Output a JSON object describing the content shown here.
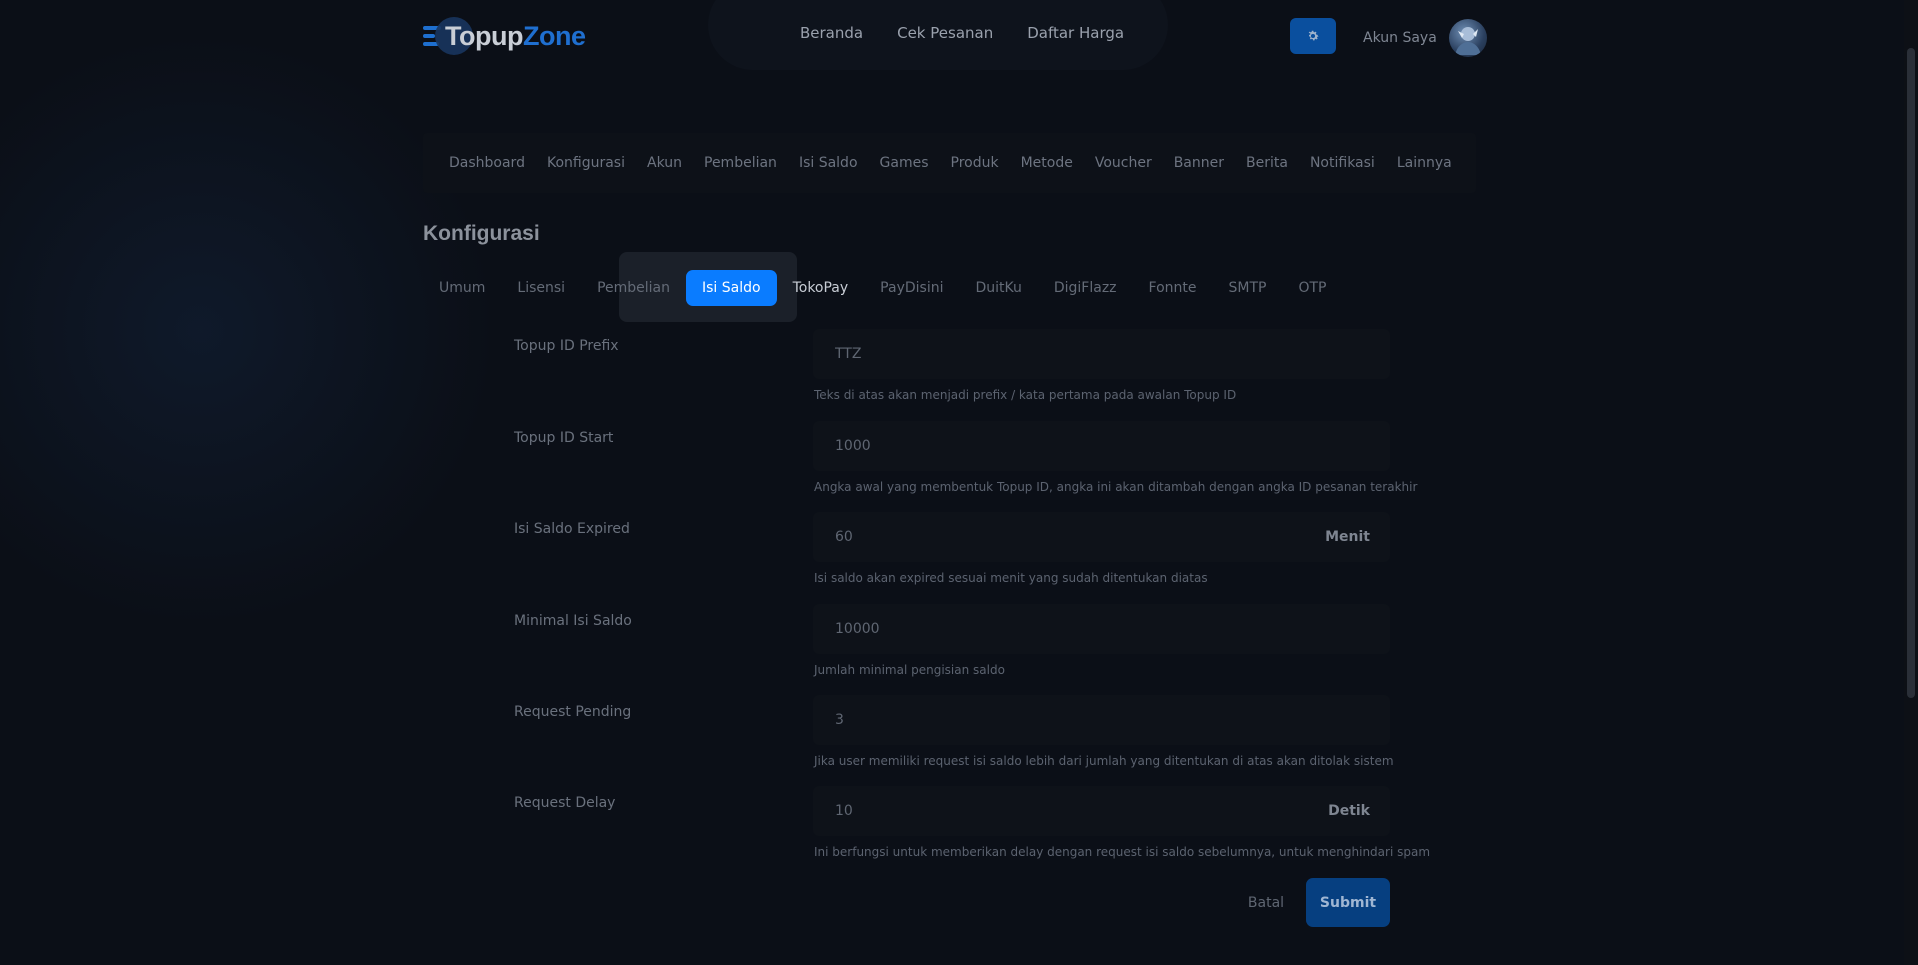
{
  "brand": {
    "part1": "Topup",
    "part2": "Zone"
  },
  "nav": {
    "links": [
      "Beranda",
      "Cek Pesanan",
      "Daftar Harga"
    ],
    "account_label": "Akun Saya"
  },
  "admin_menu": [
    "Dashboard",
    "Konfigurasi",
    "Akun",
    "Pembelian",
    "Isi Saldo",
    "Games",
    "Produk",
    "Metode",
    "Voucher",
    "Banner",
    "Berita",
    "Notifikasi",
    "Lainnya"
  ],
  "page_title": "Konfigurasi",
  "tabs": [
    "Umum",
    "Lisensi",
    "Pembelian",
    "Isi Saldo",
    "TokoPay",
    "PayDisini",
    "DuitKu",
    "DigiFlazz",
    "Fonnte",
    "SMTP",
    "OTP"
  ],
  "active_tab": "Isi Saldo",
  "form": {
    "fields": [
      {
        "label": "Topup ID Prefix",
        "value": "TTZ",
        "suffix": "",
        "help": "Teks di atas akan menjadi prefix / kata pertama pada awalan Topup ID"
      },
      {
        "label": "Topup ID Start",
        "value": "1000",
        "suffix": "",
        "help": "Angka awal yang membentuk Topup ID, angka ini akan ditambah dengan angka ID pesanan terakhir"
      },
      {
        "label": "Isi Saldo Expired",
        "value": "60",
        "suffix": "Menit",
        "help": "Isi saldo akan expired sesuai menit yang sudah ditentukan diatas"
      },
      {
        "label": "Minimal Isi Saldo",
        "value": "10000",
        "suffix": "",
        "help": "Jumlah minimal pengisian saldo"
      },
      {
        "label": "Request Pending",
        "value": "3",
        "suffix": "",
        "help": "Jika user memiliki request isi saldo lebih dari jumlah yang ditentukan di atas akan ditolak sistem"
      },
      {
        "label": "Request Delay",
        "value": "10",
        "suffix": "Detik",
        "help": "Ini berfungsi untuk memberikan delay dengan request isi saldo sebelumnya, untuk menghindari spam"
      }
    ],
    "cancel_label": "Batal",
    "submit_label": "Submit"
  },
  "colors": {
    "accent": "#0a7cff",
    "background": "#0b0f17"
  },
  "icons": {
    "settings": "gear-icon",
    "avatar": "avatar-image"
  }
}
